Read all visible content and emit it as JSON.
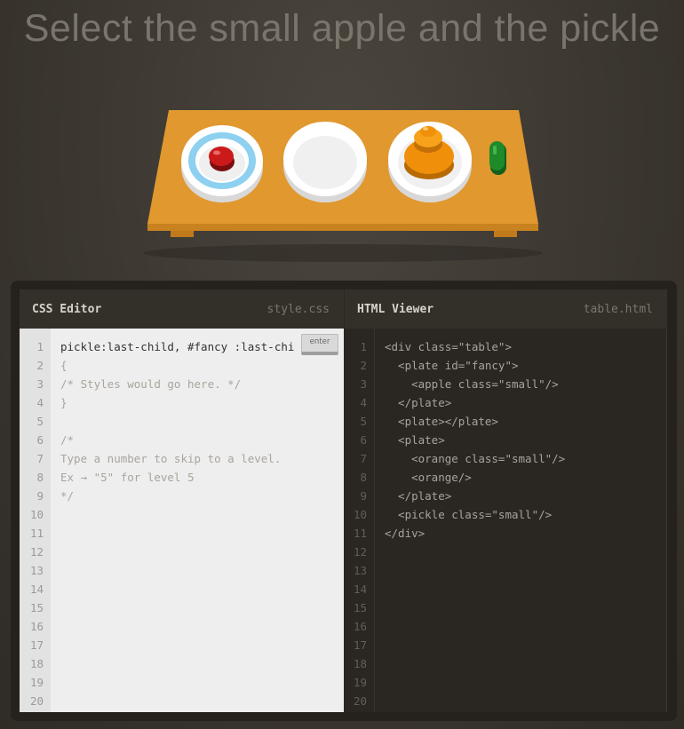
{
  "instruction": "Select the small apple and the pickle",
  "css_editor": {
    "title": "CSS Editor",
    "filename": "style.css",
    "input_value": "pickle:last-child, #fancy :last-chi",
    "enter_label": "enter",
    "lines": [
      "{",
      "/* Styles would go here. */",
      "}",
      "",
      "/*",
      "Type a number to skip to a level.",
      "Ex → \"5\" for level 5",
      "*/"
    ],
    "line_numbers": [
      "1",
      "2",
      "3",
      "4",
      "5",
      "6",
      "7",
      "8",
      "9",
      "10",
      "11",
      "12",
      "13",
      "14",
      "15",
      "16",
      "17",
      "18",
      "19",
      "20"
    ]
  },
  "html_viewer": {
    "title": "HTML Viewer",
    "filename": "table.html",
    "lines": [
      "<div class=\"table\">",
      "  <plate id=\"fancy\">",
      "    <apple class=\"small\"/>",
      "  </plate>",
      "  <plate></plate>",
      "  <plate>",
      "    <orange class=\"small\"/>",
      "    <orange/>",
      "  </plate>",
      "  <pickle class=\"small\"/>",
      "</div>"
    ],
    "line_numbers": [
      "1",
      "2",
      "3",
      "4",
      "5",
      "6",
      "7",
      "8",
      "9",
      "10",
      "11",
      "12",
      "13",
      "14",
      "15",
      "16",
      "17",
      "18",
      "19",
      "20"
    ]
  },
  "colors": {
    "table": "#e0982f",
    "apple": "#cc1a1a",
    "orange": "#f0900a",
    "pickle": "#1e8a2a",
    "fancy_ring": "#8dd0ef"
  }
}
